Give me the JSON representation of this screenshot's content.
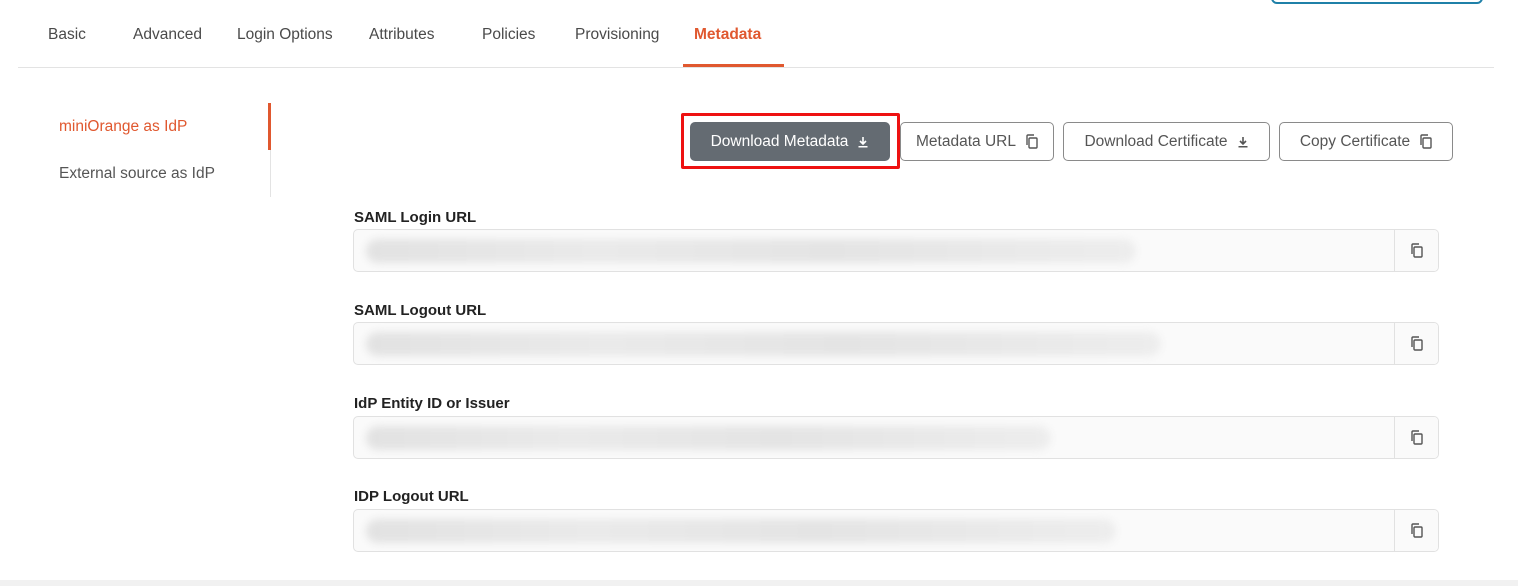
{
  "tabs": [
    {
      "label": "Basic"
    },
    {
      "label": "Advanced"
    },
    {
      "label": "Login Options"
    },
    {
      "label": "Attributes"
    },
    {
      "label": "Policies"
    },
    {
      "label": "Provisioning"
    },
    {
      "label": "Metadata",
      "active": true
    }
  ],
  "sidenav": {
    "items": [
      {
        "label": "miniOrange as IdP",
        "active": true
      },
      {
        "label": "External source as IdP"
      }
    ]
  },
  "actions": {
    "download_metadata": "Download Metadata",
    "metadata_url": "Metadata URL",
    "download_certificate": "Download Certificate",
    "copy_certificate": "Copy Certificate"
  },
  "fields": [
    {
      "label": "SAML Login URL",
      "value": ""
    },
    {
      "label": "SAML Logout URL",
      "value": ""
    },
    {
      "label": "IdP Entity ID or Issuer",
      "value": ""
    },
    {
      "label": "IDP Logout URL",
      "value": ""
    }
  ],
  "colors": {
    "accent": "#e0582f",
    "primary_button": "#646b72",
    "highlight": "#ee1111"
  },
  "icons": {
    "download": "download-icon",
    "copy": "copy-icon"
  }
}
